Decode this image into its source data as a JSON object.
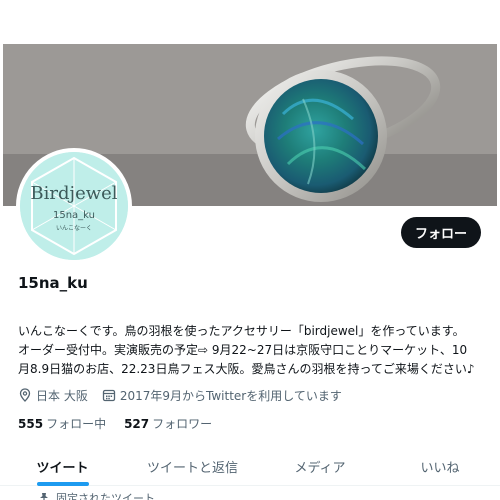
{
  "profile": {
    "avatar_text": "Birdjewel",
    "avatar_subtext": "15na_ku",
    "avatar_caption": "いんこなーく",
    "display_name": "15na_ku",
    "follow_label": "フォロー",
    "bio_line1": "いんこなーくです。鳥の羽根を使ったアクセサリー「birdjewel」を作っています。",
    "bio_line2": "オーダー受付中。実演販売の予定⇨ 9月22~27日は京阪守口ことりマーケット、10",
    "bio_line3": "月8.9日猫のお店、22.23日鳥フェス大阪。愛鳥さんの羽根を持ってご来場ください♪",
    "location": "日本 大阪",
    "joined": "2017年9月からTwitterを利用しています",
    "following_count": "555",
    "following_label": "フォロー中",
    "followers_count": "527",
    "followers_label": "フォロワー"
  },
  "tabs": [
    {
      "label": "ツイート",
      "active": true
    },
    {
      "label": "ツイートと返信",
      "active": false
    },
    {
      "label": "メディア",
      "active": false
    },
    {
      "label": "いいね",
      "active": false
    }
  ],
  "pinned_label": "固定されたツイート",
  "colors": {
    "accent": "#1d9bf0",
    "button_bg": "#0f1419",
    "secondary_text": "#536471",
    "avatar_bg": "#bfeee9"
  },
  "icons": [
    "location-icon",
    "calendar-icon",
    "pin-icon"
  ]
}
